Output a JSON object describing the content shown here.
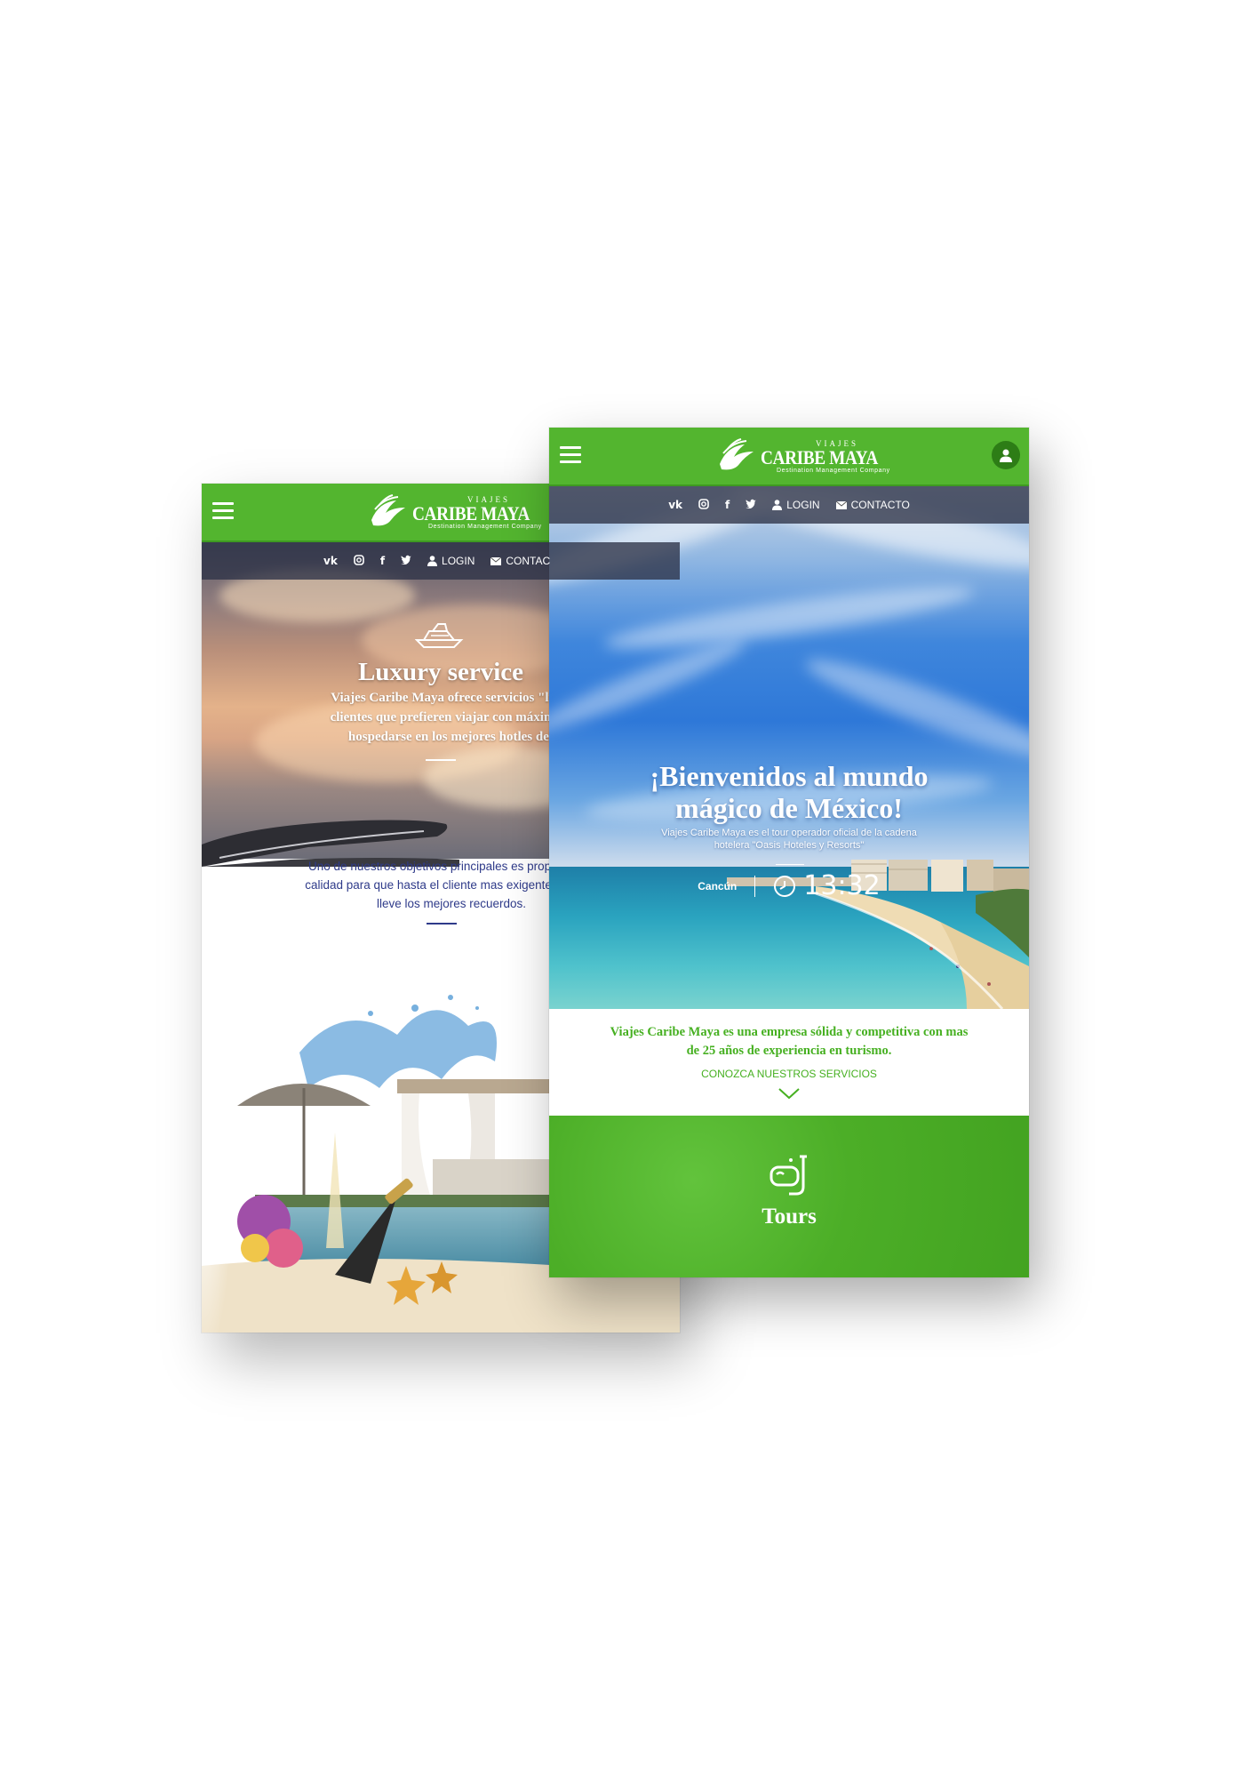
{
  "brand": {
    "small": "VIAJES",
    "name": "CARIBE MAYA",
    "tagline": "Destination Management Company"
  },
  "topbar": {
    "login": "LOGIN",
    "contact_full": "CONTACTO",
    "contact_cut": "CONTAC"
  },
  "back_screen": {
    "title": "Luxury service",
    "text_lines": [
      "Viajes Caribe Maya ofrece servicios \"luxu",
      "clientes que prefieren viajar con máxima c",
      "hospedarse en los mejores hotles del"
    ],
    "goal_lines": [
      "Uno de nuestros objetivos principales es proporcionar",
      "calidad para que hasta el cliente mas exigente se qued",
      "lleve los mejores recuerdos."
    ]
  },
  "front_screen": {
    "welcome_line1": "¡Bienvenidos al mundo",
    "welcome_line2": "mágico de México!",
    "sub_line1": "Viajes Caribe Maya es el tour operador oficial de la cadena",
    "sub_line2": "hotelera \"Oasis Hoteles y Resorts\"",
    "city": "Cancún",
    "time": "13:32",
    "intro_line1": "Viajes Caribe Maya es una empresa sólida y competitiva con mas",
    "intro_line2": "de 25 años de experiencia en turismo.",
    "services_link": "CONOZCA NUESTROS SERVICIOS",
    "tours_title": "Tours"
  },
  "colors": {
    "brand_green": "#53b52f",
    "text_green": "#46b021",
    "text_blue": "#2f3b8a"
  },
  "icons": [
    "menu-icon",
    "vk-icon",
    "instagram-icon",
    "facebook-icon",
    "twitter-icon",
    "user-icon",
    "mail-icon",
    "yacht-icon",
    "clock-icon",
    "chevron-down-icon",
    "snorkel-icon"
  ]
}
